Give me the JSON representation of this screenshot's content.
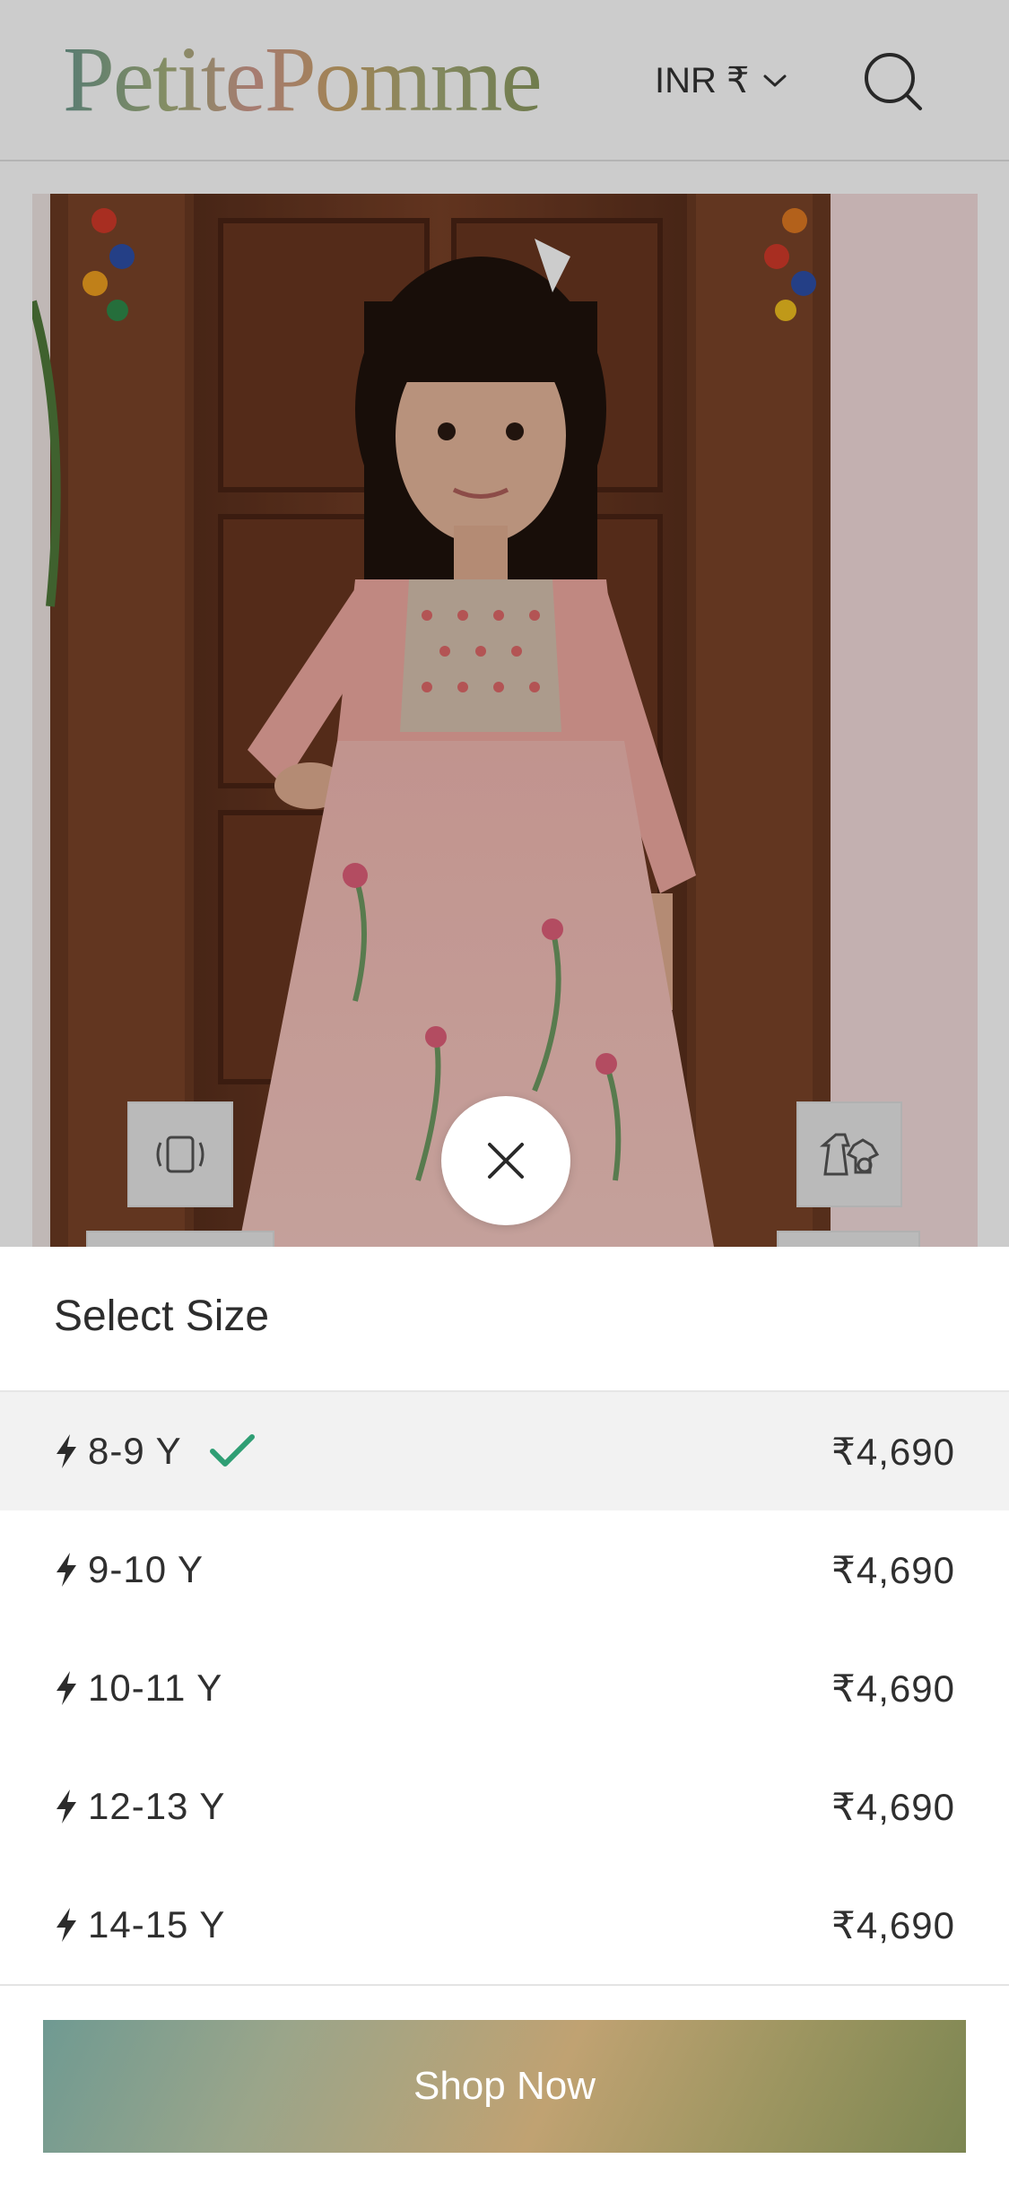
{
  "header": {
    "logo_text": "PetitePomme",
    "currency_label": "INR ₹",
    "icons": {
      "currency_dropdown": "chevron-down-icon",
      "search": "search-icon"
    }
  },
  "gallery": {
    "image_alt": "Girl in pink floral printed dress",
    "icons": {
      "left_chip": "rotate-view-icon",
      "right_chip": "outfit-icon",
      "close": "close-icon"
    }
  },
  "sheet": {
    "title": "Select Size",
    "sizes": [
      {
        "label": "8-9 Y",
        "price": "₹4,690",
        "selected": true
      },
      {
        "label": "9-10 Y",
        "price": "₹4,690",
        "selected": false
      },
      {
        "label": "10-11 Y",
        "price": "₹4,690",
        "selected": false
      },
      {
        "label": "12-13 Y",
        "price": "₹4,690",
        "selected": false
      },
      {
        "label": "14-15 Y",
        "price": "₹4,690",
        "selected": false
      }
    ],
    "row_icon": "bolt-icon",
    "selected_icon": "checkmark-icon",
    "cta_label": "Shop Now"
  },
  "colors": {
    "check": "#2f9e74",
    "overlay": "rgba(0,0,0,0.2)",
    "selected_row_bg": "#f2f2f2"
  }
}
